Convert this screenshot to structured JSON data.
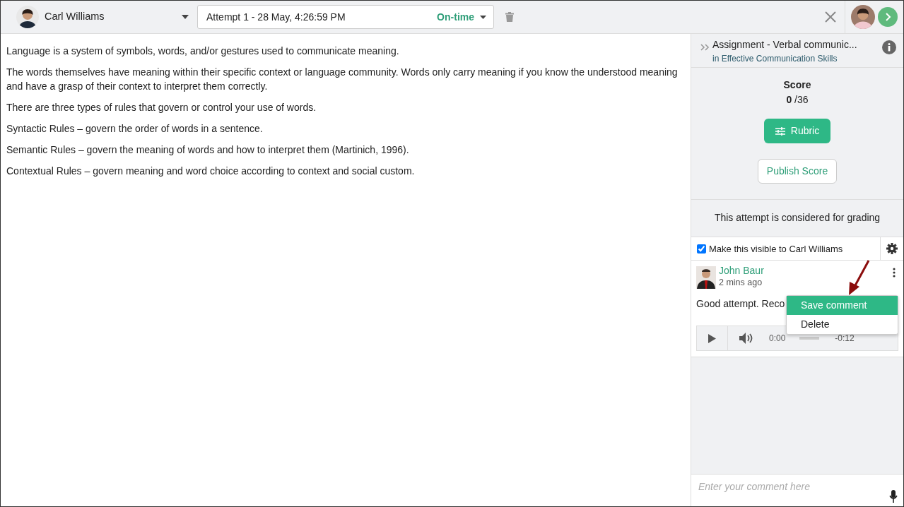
{
  "student": {
    "name": "Carl Williams"
  },
  "attempt": {
    "label": "Attempt 1 - 28 May, 4:26:59 PM",
    "status": "On-time"
  },
  "content": {
    "paragraphs": [
      "Language is a system of symbols, words, and/or gestures used to communicate meaning.",
      "The words themselves have meaning within their specific context or language community. Words only carry meaning if you know the understood meaning and have a grasp of their context to interpret them correctly.",
      "There are three types of rules that govern or control your use of words.",
      "Syntactic Rules – govern the order of words in a sentence.",
      "Semantic Rules – govern the meaning of words and how to interpret them (Martinich, 1996).",
      "Contextual Rules – govern meaning and word choice according to context and social custom."
    ]
  },
  "panel": {
    "title": "Assignment - Verbal communic...",
    "course": "in Effective Communication Skills",
    "score_label": "Score",
    "score": "0",
    "score_max": "/36",
    "rubric_button": "Rubric",
    "publish_button": "Publish Score",
    "grading_note": "This attempt is considered for grading",
    "visibility": {
      "label": "Make this visible to Carl Williams",
      "checked": true
    }
  },
  "comment": {
    "author": "John Baur",
    "time": "2 mins ago",
    "text": "Good attempt. Reco",
    "audio": {
      "elapsed": "0:00",
      "remaining": "-0:12",
      "level": 0
    }
  },
  "menu": {
    "items": [
      {
        "label": "Save comment",
        "selected": true
      },
      {
        "label": "Delete",
        "selected": false
      }
    ]
  },
  "composer": {
    "placeholder": "Enter your comment here"
  }
}
